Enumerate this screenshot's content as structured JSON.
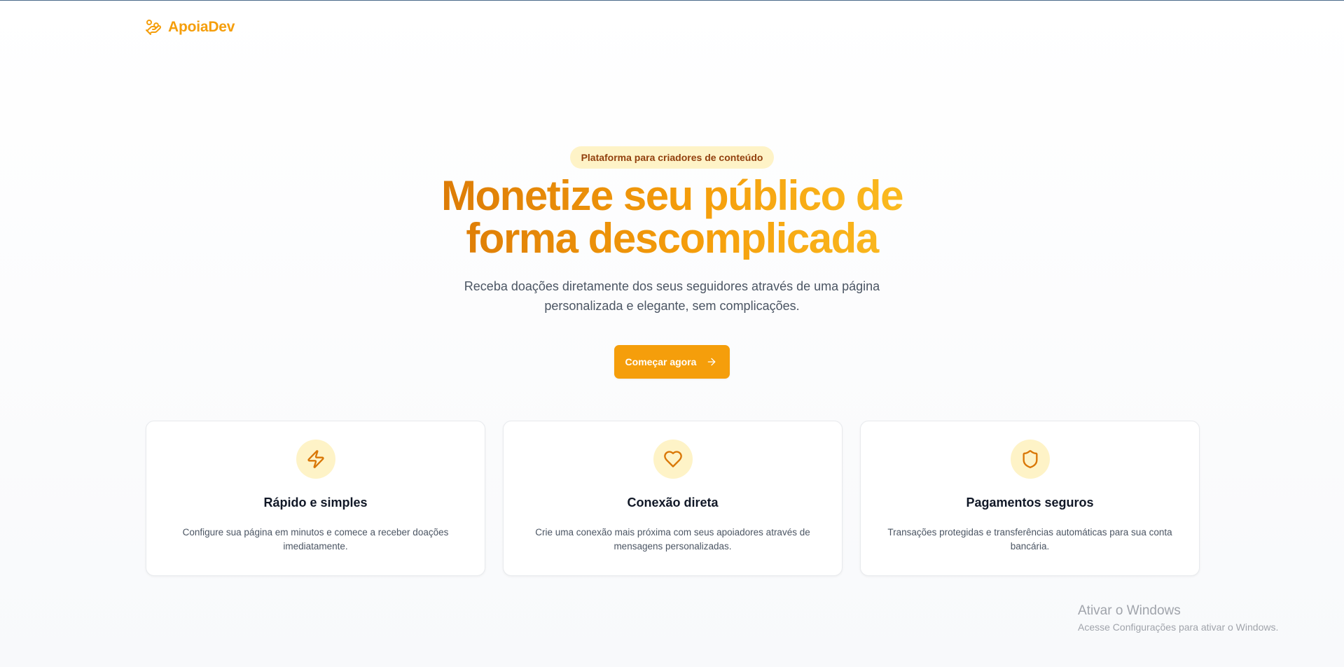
{
  "brand": {
    "name": "ApoiaDev",
    "icon": "hand-coins-icon",
    "color": "#f59e0b"
  },
  "hero": {
    "badge": "Plataforma para criadores de conteúdo",
    "headline_line1": "Monetize seu público de",
    "headline_line2": "forma descomplicada",
    "subtitle_line1": "Receba doações diretamente dos seus seguidores através de uma página",
    "subtitle_line2": "personalizada e elegante, sem complicações.",
    "cta_label": "Começar agora",
    "cta_icon": "arrow-right-icon"
  },
  "features": [
    {
      "icon": "zap-icon",
      "title": "Rápido e simples",
      "desc_line1": "Configure sua página em minutos e comece a receber doações",
      "desc_line2": "imediatamente."
    },
    {
      "icon": "heart-icon",
      "title": "Conexão direta",
      "desc_line1": "Crie uma conexão mais próxima com seus apoiadores através de",
      "desc_line2": "mensagens personalizadas."
    },
    {
      "icon": "shield-icon",
      "title": "Pagamentos seguros",
      "desc_line1": "Transações protegidas e transferências automáticas para sua conta",
      "desc_line2": "bancária."
    }
  ],
  "watermark": {
    "title": "Ativar o Windows",
    "subtitle": "Acesse Configurações para ativar o Windows."
  },
  "colors": {
    "accent": "#f59e0b",
    "accent_dark": "#d97706",
    "badge_bg": "#fef3c7",
    "badge_text": "#92400e"
  }
}
